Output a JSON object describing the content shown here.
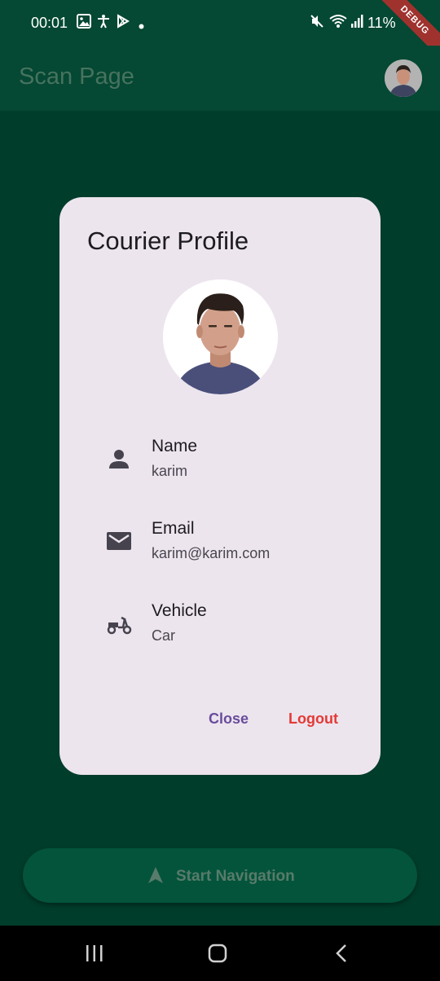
{
  "status_bar": {
    "time": "00:01",
    "battery": "11%",
    "left_icons": [
      "image-icon",
      "accessibility-icon",
      "play-store-icon",
      "dot-icon"
    ],
    "right_icons": [
      "mute-icon",
      "wifi-icon",
      "signal-icon"
    ]
  },
  "debug_banner": "DEBUG",
  "app_bar": {
    "title": "Scan Page"
  },
  "dialog": {
    "title": "Courier Profile",
    "fields": [
      {
        "label": "Name",
        "value": "karim",
        "icon": "person-icon"
      },
      {
        "label": "Email",
        "value": "karim@karim.com",
        "icon": "email-icon"
      },
      {
        "label": "Vehicle",
        "value": "Car",
        "icon": "scooter-icon"
      }
    ],
    "close_label": "Close",
    "logout_label": "Logout"
  },
  "nav_button": {
    "label": "Start Navigation",
    "icon": "navigation-arrow-icon"
  },
  "system_nav": {
    "buttons": [
      "recent-apps-icon",
      "home-icon",
      "back-icon"
    ]
  },
  "colors": {
    "background": "#003d2b",
    "app_bar": "#054833",
    "dialog": "#ece5ee",
    "close": "#6a4c9c",
    "logout": "#e53935"
  }
}
